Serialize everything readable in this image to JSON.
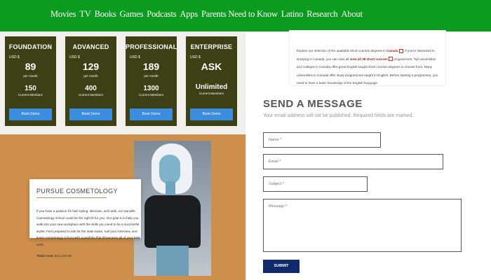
{
  "nav": {
    "links": [
      "Movies",
      "TV",
      "Books",
      "Games",
      "Podcasts",
      "Apps",
      "Parents Need to Know",
      "Latino",
      "Research",
      "About"
    ]
  },
  "pricing": {
    "plans": [
      {
        "name": "FOUNDATION",
        "currency": "USD $",
        "price": "89",
        "per": "per month",
        "members": "150",
        "members_label": "Current Members",
        "button": "Book Demo"
      },
      {
        "name": "ADVANCED",
        "currency": "USD $",
        "price": "129",
        "per": "per month",
        "members": "400",
        "members_label": "Current Members",
        "button": "Book Demo"
      },
      {
        "name": "PROFESSIONAL",
        "currency": "USD $",
        "price": "189",
        "per": "per month",
        "members": "1300",
        "members_label": "Current Members",
        "button": "Book Demo"
      },
      {
        "name": "ENTERPRISE",
        "currency": "USD $",
        "price": "ASK",
        "per": "",
        "members": "Unlimited",
        "members_label": "Current Members",
        "button": "Book Demo"
      }
    ]
  },
  "info": {
    "t1": "Explore our selection of the available short courses degrees in ",
    "canada": "Canada",
    "t2": ". If you're interested in studying in Canada, you can view all ",
    "link": "view all 38 short courses",
    "t3": " programmes. Top universities and colleges in Canada offer great English-taught short courses degrees to choose from. Many universities in Canada offer study programmes taught in English. Before starting a programme, you need to have a basic knowledge of the English language."
  },
  "cosmetology": {
    "title": "PURSUE COSMETOLOGY",
    "text": "If you have a passion for hair styling, skincare, and nails, our Danville cosmetology school could be the right fit for you. Our goal is to help you walk into your new workplace with the skills you need to be a successful stylist. Feel prepared to ask for the state exam, nail your interview, and leave cosmetology school with a portfolio that showcases all of your best work.",
    "cost_label": "Total Cost:",
    "cost_value": "$14,104.00"
  },
  "form": {
    "title": "SEND A MESSAGE",
    "note": "Your email address will not be published. Required fields are marked.",
    "name_ph": "Name *",
    "email_ph": "Email *",
    "subject_ph": "Subject *",
    "message_ph": "Message *",
    "submit": "SUBMIT"
  }
}
